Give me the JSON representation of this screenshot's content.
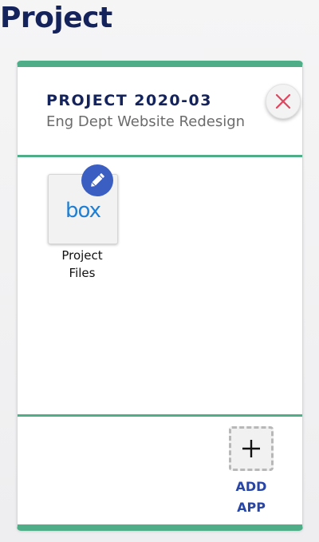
{
  "page": {
    "title": "Project"
  },
  "project_card": {
    "code": "PROJECT 2020-03",
    "name": "Eng Dept Website Redesign",
    "close_icon": "close-x-icon",
    "apps": [
      {
        "logo_text": "box",
        "label_line1": "Project",
        "label_line2": "Files",
        "icon": "box-logo",
        "badge_icon": "pencil-edit-icon"
      }
    ],
    "add_app": {
      "label_line1": "ADD",
      "label_line2": "APP",
      "icon": "plus-icon"
    }
  },
  "colors": {
    "navy": "#14235b",
    "accent_green": "#4fae88",
    "close_red": "#e0455f",
    "edit_blue": "#3b5ec2",
    "add_blue": "#2845a8",
    "box_blue": "#1f7fd4"
  }
}
